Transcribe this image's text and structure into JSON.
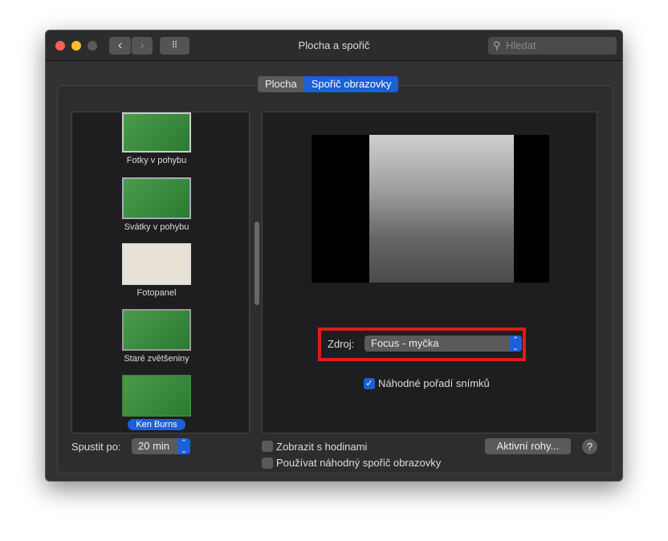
{
  "window": {
    "title": "Plocha a spořič",
    "search_placeholder": "Hledat"
  },
  "tabs": [
    {
      "label": "Plocha"
    },
    {
      "label": "Spořič obrazovky",
      "active": true
    }
  ],
  "savers": [
    {
      "label": "Fotky v pohybu"
    },
    {
      "label": "Svátky v pohybu"
    },
    {
      "label": "Fotopanel"
    },
    {
      "label": "Staré zvětšeniny"
    },
    {
      "label": "Ken Burns",
      "selected": true
    }
  ],
  "source": {
    "label": "Zdroj:",
    "value": "Focus - myčka"
  },
  "shuffle": {
    "label": "Náhodné pořadí snímků",
    "checked": true
  },
  "start_after": {
    "label": "Spustit po:",
    "value": "20 min"
  },
  "show_clock": {
    "label": "Zobrazit s hodinami",
    "checked": false
  },
  "random_saver": {
    "label": "Používat náhodný spořič obrazovky",
    "checked": false
  },
  "hot_corners": "Aktivní rohy...",
  "help": "?",
  "colors": {
    "accent": "#1b5fd9",
    "highlight": "#e01b1b"
  }
}
